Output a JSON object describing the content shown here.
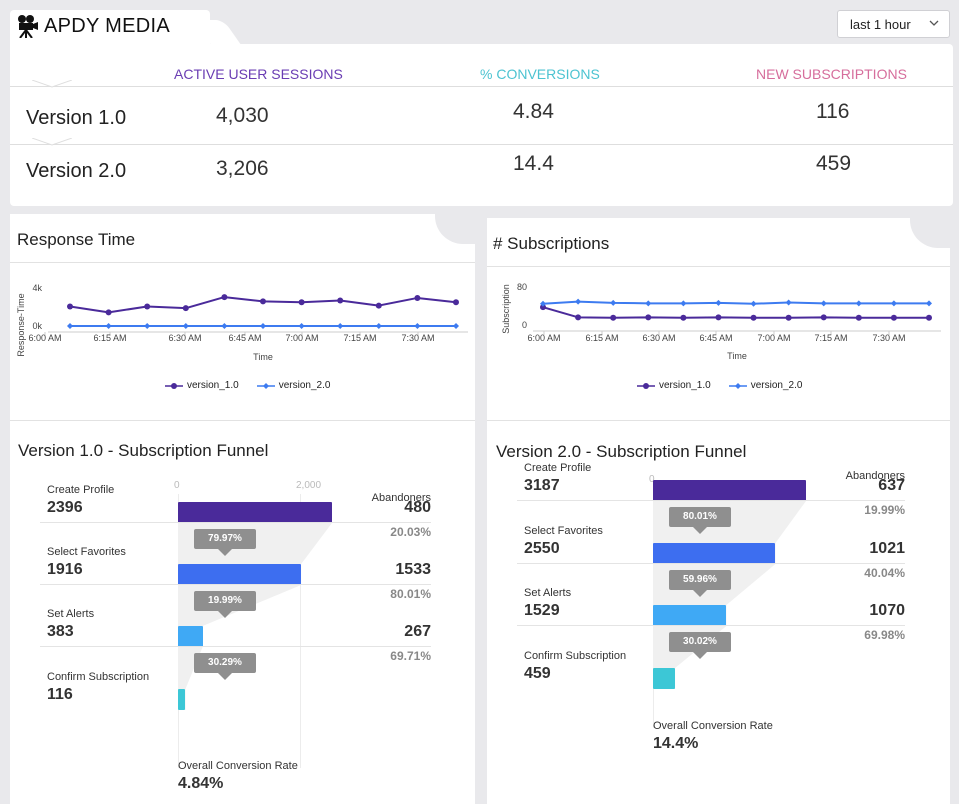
{
  "header": {
    "brand": "APDY MEDIA",
    "brand_icon": "movie-camera-icon",
    "time_range": "last 1 hour"
  },
  "summary": {
    "columns": [
      {
        "label": "ACTIVE USER SESSIONS",
        "color": "#6a3db3"
      },
      {
        "label": "% CONVERSIONS",
        "color": "#4cc3d1"
      },
      {
        "label": "NEW SUBSCRIPTIONS",
        "color": "#d66e9c"
      }
    ],
    "rows": [
      {
        "version": "Version 1.0",
        "sessions": "4,030",
        "conversions": "4.84",
        "subscriptions": "116"
      },
      {
        "version": "Version 2.0",
        "sessions": "3,206",
        "conversions": "14.4",
        "subscriptions": "459"
      }
    ]
  },
  "response_time": {
    "title": "Response Time",
    "ylabel": "Response-Time",
    "xlabel": "Time",
    "legend": [
      "version_1.0",
      "version_2.0"
    ]
  },
  "subscriptions_chart": {
    "title": "# Subscriptions",
    "ylabel": "Subscription",
    "xlabel": "Time",
    "legend": [
      "version_1.0",
      "version_2.0"
    ]
  },
  "chart_data": [
    {
      "type": "line",
      "title": "Response Time",
      "xlabel": "Time",
      "ylabel": "Response-Time",
      "x_ticks": [
        "6:00 AM",
        "6:15 AM",
        "6:30 AM",
        "6:45 AM",
        "7:00 AM",
        "7:15 AM",
        "7:30 AM"
      ],
      "y_ticks": [
        "0k",
        "4k"
      ],
      "ylim": [
        0,
        4000
      ],
      "series": [
        {
          "name": "version_1.0",
          "color": "#4a2a9a",
          "values": [
            2300,
            1600,
            2300,
            2100,
            3400,
            2900,
            2800,
            3000,
            2400,
            3300,
            2800
          ]
        },
        {
          "name": "version_2.0",
          "color": "#3d7bf0",
          "values": [
            0,
            0,
            0,
            0,
            0,
            0,
            0,
            0,
            0,
            0,
            0
          ]
        }
      ],
      "grid": false,
      "legend": "bottom"
    },
    {
      "type": "line",
      "title": "# Subscriptions",
      "xlabel": "Time",
      "ylabel": "Subscription",
      "x_ticks": [
        "6:00 AM",
        "6:15 AM",
        "6:30 AM",
        "6:45 AM",
        "7:00 AM",
        "7:15 AM",
        "7:30 AM"
      ],
      "y_ticks": [
        "0",
        "80"
      ],
      "ylim": [
        0,
        80
      ],
      "series": [
        {
          "name": "version_1.0",
          "color": "#4a2a9a",
          "values": [
            42,
            18,
            17,
            18,
            17,
            18,
            17,
            17,
            18,
            17,
            17,
            17
          ]
        },
        {
          "name": "version_2.0",
          "color": "#3d7bf0",
          "values": [
            50,
            55,
            52,
            51,
            51,
            52,
            50,
            53,
            51,
            51,
            51,
            51
          ]
        }
      ],
      "grid": false,
      "legend": "bottom"
    }
  ],
  "funnel_v1": {
    "title": "Version 1.0 - Subscription Funnel",
    "axis_ticks": [
      "0",
      "2,000"
    ],
    "abandoners_label": "Abandoners",
    "overall_label": "Overall Conversion Rate",
    "overall_value": "4.84%",
    "stages": [
      {
        "label": "Create Profile",
        "value": "2396",
        "count": 2396,
        "color": "#4a2a9a"
      },
      {
        "label": "Select Favorites",
        "value": "1916",
        "count": 1916,
        "color": "#3d6ef0"
      },
      {
        "label": "Set Alerts",
        "value": "383",
        "count": 383,
        "color": "#3fa9f5"
      },
      {
        "label": "Confirm Subscription",
        "value": "116",
        "count": 116,
        "color": "#3cc7d6"
      }
    ],
    "conversions": [
      "79.97%",
      "19.99%",
      "30.29%"
    ],
    "abandoners": [
      {
        "value": "480",
        "pct": "20.03%"
      },
      {
        "value": "1533",
        "pct": "80.01%"
      },
      {
        "value": "267",
        "pct": "69.71%"
      }
    ]
  },
  "funnel_v2": {
    "title": "Version 2.0 - Subscription Funnel",
    "axis_ticks": [
      "0"
    ],
    "abandoners_label": "Abandoners",
    "overall_label": "Overall Conversion Rate",
    "overall_value": "14.4%",
    "stages": [
      {
        "label": "Create Profile",
        "value": "3187",
        "count": 3187,
        "color": "#4a2a9a"
      },
      {
        "label": "Select Favorites",
        "value": "2550",
        "count": 2550,
        "color": "#3d6ef0"
      },
      {
        "label": "Set Alerts",
        "value": "1529",
        "count": 1529,
        "color": "#3fa9f5"
      },
      {
        "label": "Confirm Subscription",
        "value": "459",
        "count": 459,
        "color": "#3cc7d6"
      }
    ],
    "conversions": [
      "80.01%",
      "59.96%",
      "30.02%"
    ],
    "abandoners": [
      {
        "value": "637",
        "pct": "19.99%"
      },
      {
        "value": "1021",
        "pct": "40.04%"
      },
      {
        "value": "1070",
        "pct": "69.98%"
      }
    ]
  }
}
